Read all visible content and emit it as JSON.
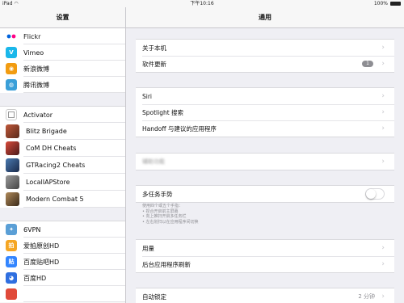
{
  "statusbar": {
    "left": "iPad ◠",
    "time": "下午10:16",
    "battery": "100%"
  },
  "sidebar": {
    "title": "设置",
    "group1": [
      {
        "label": "Flickr",
        "icon": "flickr-icon",
        "color": "#ffffff"
      },
      {
        "label": "Vimeo",
        "icon": "vimeo-icon",
        "color": "#1ab7ea"
      },
      {
        "label": "新浪微博",
        "icon": "weibo-icon",
        "color": "#f29c11"
      },
      {
        "label": "腾讯微博",
        "icon": "tencent-weibo-icon",
        "color": "#3a9fd8"
      }
    ],
    "group2": [
      {
        "label": "Activator",
        "icon": "activator-icon",
        "color": "#ffffff"
      },
      {
        "label": "Blitz Brigade",
        "icon": "blitz-brigade-icon",
        "color": "#8a3b2a"
      },
      {
        "label": "CoM DH Cheats",
        "icon": "com-dh-cheats-icon",
        "color": "#b0352a"
      },
      {
        "label": "GTRacing2 Cheats",
        "icon": "gtracing2-cheats-icon",
        "color": "#2d4f7c"
      },
      {
        "label": "LocalIAPStore",
        "icon": "localiapstore-icon",
        "color": "#6b6b6b"
      },
      {
        "label": "Modern Combat 5",
        "icon": "modern-combat-5-icon",
        "color": "#7a5a3a"
      }
    ],
    "group3": [
      {
        "label": "6VPN",
        "icon": "vpn-icon",
        "color": "#5a9fd6"
      },
      {
        "label": "爱拍原创HD",
        "icon": "aipai-icon",
        "color": "#f5a623"
      },
      {
        "label": "百度贴吧HD",
        "icon": "baidu-tieba-icon",
        "color": "#3385ff"
      },
      {
        "label": "百度HD",
        "icon": "baidu-icon",
        "color": "#2f6fe0"
      }
    ]
  },
  "main": {
    "title": "通用",
    "group1": {
      "about": "关于本机",
      "software_update": "软件更新",
      "update_badge": "1"
    },
    "group2": {
      "siri": "Siri",
      "spotlight": "Spotlight 搜索",
      "handoff": "Handoff 与建议的应用程序"
    },
    "group3": {
      "blurred": "辅助功能"
    },
    "multitasking": {
      "label": "多任务手势",
      "note": [
        "使用四个或五个手指：",
        "• 捏合开启前主屏幕",
        "• 向上推扫开启多任务栏",
        "• 左右划扫以在应用程序间切换"
      ]
    },
    "group5": {
      "usage": "用量",
      "background_refresh": "后台应用程序刷新"
    },
    "group6": {
      "auto_lock": "自动锁定",
      "auto_lock_value": "2 分钟"
    }
  }
}
